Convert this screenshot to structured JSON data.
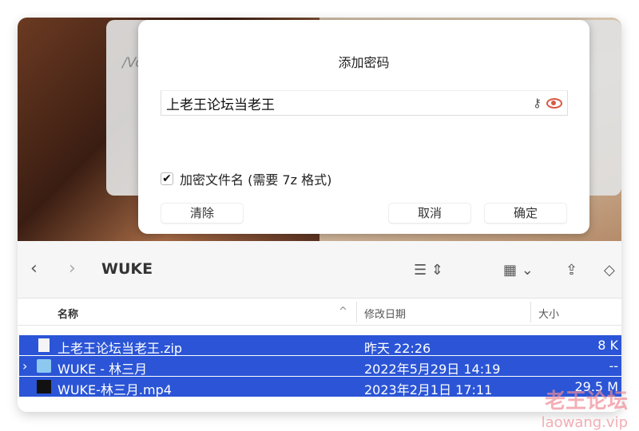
{
  "background_sheet": {
    "path_fragment": "/Vo"
  },
  "dialog": {
    "title": "添加密码",
    "password_value": "上老王论坛当老王",
    "encrypt_names_label": "加密文件名 (需要 7z 格式)",
    "encrypt_names_checked": true,
    "clear_label": "清除",
    "cancel_label": "取消",
    "ok_label": "确定"
  },
  "toolbar": {
    "folder": "WUKE"
  },
  "columns": {
    "name": "名称",
    "date": "修改日期",
    "size": "大小"
  },
  "files": [
    {
      "name": "上老王论坛当老王.zip",
      "date": "昨天 22:26",
      "size": "8 K",
      "type": "zip"
    },
    {
      "name": "WUKE - 林三月",
      "date": "2022年5月29日 14:19",
      "size": "--",
      "type": "folder"
    },
    {
      "name": "WUKE-林三月.mp4",
      "date": "2023年2月1日 17:11",
      "size": "29.5 M",
      "type": "video"
    }
  ],
  "selection_color": "#2b55d6",
  "watermark": {
    "line1": "老王论坛",
    "line2": "laowang.vip"
  }
}
